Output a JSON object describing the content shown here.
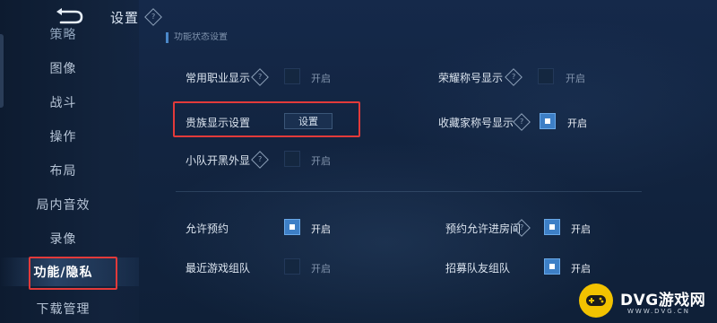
{
  "header": {
    "title": "设置",
    "section_title": "功能状态设置"
  },
  "sidebar": {
    "items": [
      {
        "label": "策略",
        "state": "partial"
      },
      {
        "label": "图像"
      },
      {
        "label": "战斗"
      },
      {
        "label": "操作"
      },
      {
        "label": "布局"
      },
      {
        "label": "局内音效"
      },
      {
        "label": "录像"
      },
      {
        "label": "功能/隐私",
        "state": "active"
      },
      {
        "label": "下载管理"
      }
    ]
  },
  "settings": {
    "group1": [
      {
        "label": "常用职业显示",
        "has_help": true,
        "control": "checkbox",
        "checked": false,
        "state_label": "开启"
      },
      {
        "label": "荣耀称号显示",
        "has_help": true,
        "control": "checkbox",
        "checked": false,
        "state_label": "开启"
      },
      {
        "label": "贵族显示设置",
        "has_help": false,
        "control": "button",
        "button_label": "设置"
      },
      {
        "label": "收藏家称号显示",
        "has_help": true,
        "control": "checkbox",
        "checked": true,
        "state_label": "开启"
      },
      {
        "label": "小队开黑外显",
        "has_help": true,
        "control": "checkbox",
        "checked": false,
        "state_label": "开启"
      }
    ],
    "group2": [
      {
        "label": "允许预约",
        "has_help": false,
        "control": "checkbox",
        "checked": true,
        "state_label": "开启"
      },
      {
        "label": "预约允许进房间",
        "has_help": true,
        "control": "checkbox",
        "checked": true,
        "state_label": "开启"
      },
      {
        "label": "最近游戏组队",
        "has_help": false,
        "control": "checkbox",
        "checked": false,
        "state_label": "开启"
      },
      {
        "label": "招募队友组队",
        "has_help": false,
        "control": "checkbox",
        "checked": true,
        "state_label": "开启"
      }
    ]
  },
  "watermark": {
    "text": "DVG游戏网",
    "url": "WWW.DVG.CN"
  },
  "colors": {
    "highlight_box": "#e23a3a",
    "checkbox_on": "#3d7fc6",
    "watermark_logo": "#f2c200"
  }
}
